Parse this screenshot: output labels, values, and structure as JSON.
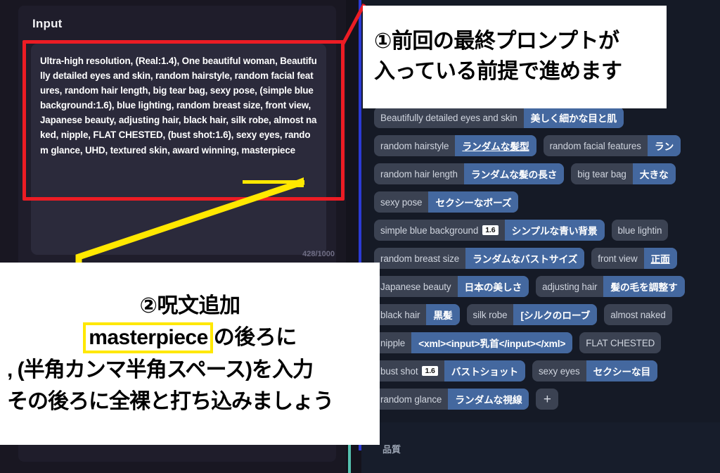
{
  "left_panel": {
    "input_label": "Input",
    "prompt_text": "Ultra-high resolution, (Real:1.4), One beautiful woman, Beautifully detailed eyes and skin, random hairstyle, random facial features, random hair length, big tear bag, sexy pose, (simple blue background:1.6), blue lighting, random breast size, front view, Japanese beauty, adjusting hair, black hair, silk robe, almost naked, nipple, FLAT CHESTED, (bust shot:1.6), sexy eyes, random glance, UHD, textured skin, award winning, masterpiece",
    "char_counter": "428/1000"
  },
  "right_panel": {
    "quality_label": "品質",
    "add_button_label": "+",
    "chip_rows": [
      [
        {
          "en": "Beautifully detailed eyes and skin",
          "ja": "美しく細かな目と肌"
        }
      ],
      [
        {
          "en": "random hairstyle",
          "ja": "ランダムな髪型",
          "ja_underline": true
        },
        {
          "en": "random facial features",
          "ja": "ラン"
        }
      ],
      [
        {
          "en": "random hair length",
          "ja": "ランダムな髪の長さ"
        },
        {
          "en": "big tear bag",
          "ja": "大きな"
        }
      ],
      [
        {
          "en": "sexy pose",
          "ja": "セクシーなポーズ"
        }
      ],
      [
        {
          "en": "simple blue background",
          "weight": "1.6",
          "ja": "シンプルな青い背景"
        },
        {
          "en": "blue lightin",
          "ja": ""
        }
      ],
      [
        {
          "en": "random breast size",
          "ja": "ランダムなバストサイズ"
        },
        {
          "en": "front view",
          "ja": "正面",
          "ja_underline": true
        }
      ],
      [
        {
          "en": "Japanese beauty",
          "ja": "日本の美しさ"
        },
        {
          "en": "adjusting hair",
          "ja": "髪の毛を調整す"
        }
      ],
      [
        {
          "en": "black hair",
          "ja": "黒髪"
        },
        {
          "en": "silk robe",
          "ja": "[シルクのローブ"
        },
        {
          "en": "almost naked",
          "ja": ""
        }
      ],
      [
        {
          "en": "nipple",
          "ja": "<xml><input>乳首</input></xml>"
        },
        {
          "en": "FLAT CHESTED",
          "ja": ""
        }
      ],
      [
        {
          "en": "bust shot",
          "weight": "1.6",
          "ja": "バストショット"
        },
        {
          "en": "sexy eyes",
          "ja": "セクシーな目"
        }
      ],
      [
        {
          "en": "random glance",
          "ja": "ランダムな視線",
          "add_after": true
        }
      ]
    ]
  },
  "annotations": {
    "callout_1": {
      "lines": [
        "①前回の最終プロンプトが",
        "入っている前提で進めます"
      ]
    },
    "callout_2": {
      "heading": "②呪文追加",
      "highlight_word": "masterpiece",
      "line2_rest": "の後ろに",
      "line3": ", (半角カンマ半角スペース)を入力",
      "line4": "その後ろに全裸と打ち込みましょう"
    }
  },
  "colors": {
    "red_box": "#ec1c24",
    "yellow": "#ffe800",
    "chip_blue": "#44689f",
    "chip_gray": "#3b4252",
    "divider_blue": "#2b3ad4",
    "divider_teal": "#55c0ae"
  }
}
